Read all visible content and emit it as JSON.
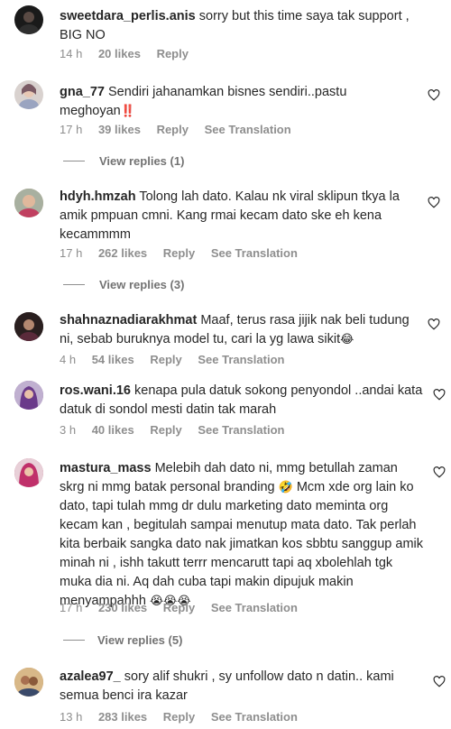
{
  "comments": [
    {
      "username": "sweetdara_perlis.anis",
      "text": " sorry but this time saya tak support , BIG NO",
      "time": "14 h",
      "likes": "20 likes",
      "reply": "Reply",
      "see_translation": "",
      "avatar_color": "#1a1a1a"
    },
    {
      "username": "gna_77",
      "text": " Sendiri jahanamkan bisnes sendiri..pastu meghoyan",
      "emoji": "‼️",
      "time": "17 h",
      "likes": "39 likes",
      "reply": "Reply",
      "see_translation": "See Translation",
      "view_replies": "View replies (1)",
      "avatar_color": "#d9d2cf"
    },
    {
      "username": "hdyh.hmzah",
      "text": " Tolong lah dato. Kalau nk viral sklipun tkya la amik pmpuan cmni. Kang rmai kecam dato ske eh kena kecammmm",
      "time": "17 h",
      "likes": "262 likes",
      "reply": "Reply",
      "see_translation": "See Translation",
      "view_replies": "View replies (3)",
      "avatar_color": "#c9a37c"
    },
    {
      "username": "shahnaznadiarakhmat",
      "text": " Maaf, terus rasa jijik nak beli tudung ni, sebab buruknya model tu, cari la yg lawa sikit",
      "emoji": "😂",
      "time": "4 h",
      "likes": "54 likes",
      "reply": "Reply",
      "see_translation": "See Translation",
      "avatar_color": "#3a2b2b"
    },
    {
      "username": "ros.wani.16",
      "text": " kenapa pula datuk sokong penyondol ..andai kata datuk di sondol mesti datin tak marah",
      "time": "3 h",
      "likes": "40 likes",
      "reply": "Reply",
      "see_translation": "See Translation",
      "avatar_color": "#7d5a8f"
    },
    {
      "username": "mastura_mass",
      "text_a": " Melebih dah dato ni, mmg betullah zaman skrg ni mmg batak personal branding ",
      "emoji_a": "🤣",
      "text_b": " Mcm xde org lain ko dato, tapi tulah mmg dr dulu marketing dato meminta org kecam kan , begitulah sampai menutup mata dato. Tak perlah kita berbaik sangka dato nak jimatkan kos sbbtu sanggup amik minah ni , ishh takutt terrr mencarutt tapi aq xbolehlah tgk muka dia ni. Aq dah cuba tapi makin dipujuk makin menyampahhh ",
      "emoji_b": "😭😭😭",
      "time": "17 h",
      "likes": "230 likes",
      "reply": "Reply",
      "see_translation": "See Translation",
      "view_replies": "View replies (5)",
      "avatar_color": "#b54a6a"
    },
    {
      "username": "azalea97_",
      "text": " sory alif shukri , sy unfollow dato n datin.. kami semua benci ira kazar",
      "time": "13 h",
      "likes": "283 likes",
      "reply": "Reply",
      "see_translation": "See Translation",
      "avatar_color": "#c08a4a"
    }
  ]
}
